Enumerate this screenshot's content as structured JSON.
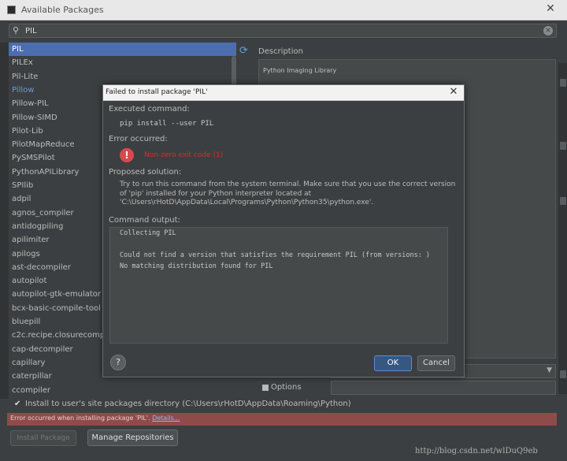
{
  "window": {
    "title": "Available Packages"
  },
  "search": {
    "value": "PIL"
  },
  "packages": [
    "PIL",
    "PILEx",
    "Pil-Lite",
    "Pillow",
    "Pillow-PIL",
    "Pillow-SIMD",
    "Pilot-Lib",
    "PilotMapReduce",
    "PySMSPilot",
    "PythonAPILibrary",
    "SPIlib",
    "adpil",
    "agnos_compiler",
    "antidogpiling",
    "apilimiter",
    "apilogs",
    "ast-decompiler",
    "autopilot",
    "autopilot-gtk-emulator",
    "bcx-basic-compile-tool",
    "bluepill",
    "c2c.recipe.closurecompile",
    "cap-decompiler",
    "capillary",
    "caterpillar",
    "ccompiler"
  ],
  "selected_package": "PIL",
  "description": {
    "label": "Description",
    "text": "Python Imaging Library"
  },
  "options": {
    "label": "Options"
  },
  "user_site": {
    "label": "Install to user's site packages directory (C:\\Users\\rHotD\\AppData\\Roaming\\Python)"
  },
  "error_bar": {
    "message": "Error occurred when installing package 'PIL'.",
    "link": "Details..."
  },
  "buttons": {
    "install": "Install Package",
    "manage_repos": "Manage Repositories"
  },
  "watermark": "http://blog.csdn.net/wlDuQ9eb",
  "dialog": {
    "title": "Failed to install package 'PIL'",
    "executed_label": "Executed command:",
    "executed_command": "pip install --user PIL",
    "error_label": "Error occurred:",
    "error_text": "Non-zero exit code (1)",
    "solution_label": "Proposed solution:",
    "solution_text": "Try to run this command from the system terminal. Make sure that you use the correct version of 'pip' installed for your Python interpreter located at 'C:\\Users\\rHotD\\AppData\\Local\\Programs\\Python\\Python35\\python.exe'.",
    "output_label": "Command output:",
    "output_lines": [
      "Collecting PIL",
      "  Could not find a version that satisfies the requirement PIL (from versions: )",
      "No matching distribution found for PIL"
    ],
    "ok": "OK",
    "cancel": "Cancel",
    "help": "?"
  },
  "colors": {
    "selection": "#4b6eaf",
    "error_bar": "#8f4a4a",
    "error_text": "#d03030",
    "ok_button": "#365880"
  }
}
